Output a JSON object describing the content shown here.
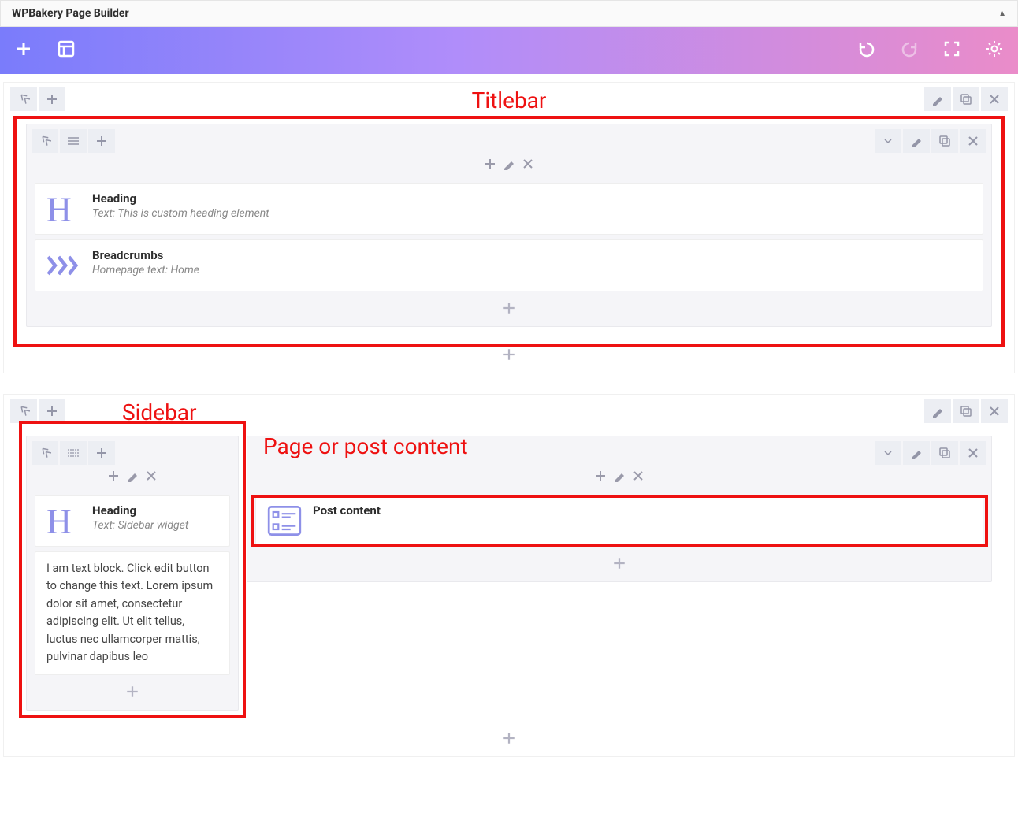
{
  "header": {
    "title": "WPBakery Page Builder"
  },
  "annotations": {
    "titlebar": "Titlebar",
    "sidebar": "Sidebar",
    "content": "Page or post content"
  },
  "section1": {
    "col1": {
      "elements": [
        {
          "name": "Heading",
          "sub": "Text: This is custom heading element"
        },
        {
          "name": "Breadcrumbs",
          "sub": "Homepage text: Home"
        }
      ]
    }
  },
  "section2": {
    "sidebar_col": {
      "heading_name": "Heading",
      "heading_sub": "Text: Sidebar widget",
      "textblock": "I am text block. Click edit button to change this text. Lorem ipsum dolor sit amet, consectetur adipiscing elit. Ut elit tellus, luctus nec ullamcorper mattis, pulvinar dapibus leo"
    },
    "content_col": {
      "post_content_name": "Post content"
    }
  }
}
